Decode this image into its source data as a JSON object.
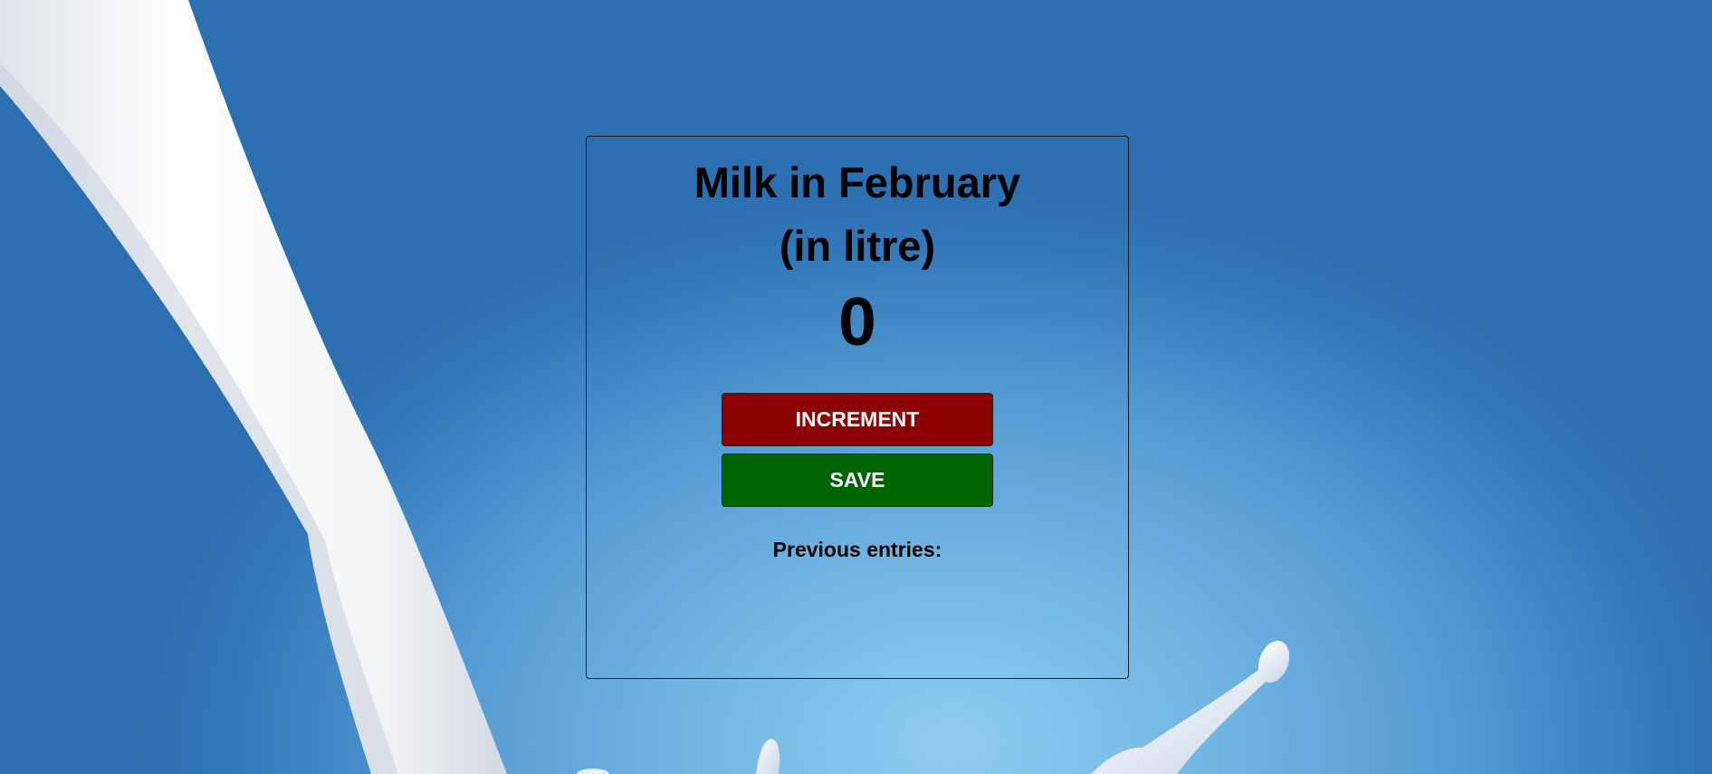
{
  "counter": {
    "title_line1": "Milk in February",
    "title_line2": "(in litre)",
    "value": "0",
    "increment_label": "INCREMENT",
    "save_label": "SAVE",
    "previous_label": "Previous entries:"
  },
  "entries": [],
  "colors": {
    "increment": "#8b0000",
    "save": "#006400",
    "background": "#4a90d0",
    "milk": "#ffffff"
  }
}
